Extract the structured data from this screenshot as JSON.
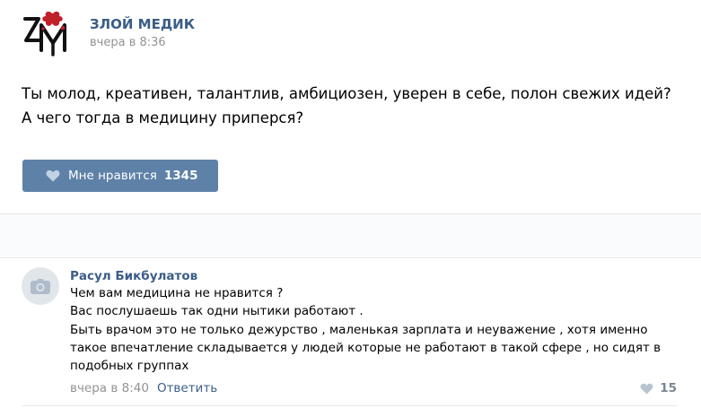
{
  "post": {
    "group_name": "ЗЛОЙ МЕДИК",
    "time": "вчера в 8:36",
    "text": "Ты молод, креативен, талантлив, амбициозен, уверен в себе, полон свежих идей? А чего тогда в медицину приперся?",
    "like_label": "Мне нравится",
    "like_count": "1345"
  },
  "comment": {
    "author": "Расул Бикбулатов",
    "lines": [
      "Чем вам медицина не нравится ?",
      "Вас послушаешь так одни нытики работают .",
      "Быть врачом это не только дежурство , маленькая зарплата и неуважение , хотя именно",
      "такое впечатление складывается у людей которые не работают в такой сфере , но сидят в",
      "подобных группах"
    ],
    "time": "вчера в 8:40",
    "reply_label": "Ответить",
    "likes": "15"
  },
  "icons": {
    "logo": "group-logo-icon",
    "like": "heart-icon",
    "avatar": "camera-icon"
  },
  "colors": {
    "link": "#3b5d87",
    "like_button": "#5e81a8",
    "muted": "#939393",
    "logo_accent": "#c0202a"
  }
}
